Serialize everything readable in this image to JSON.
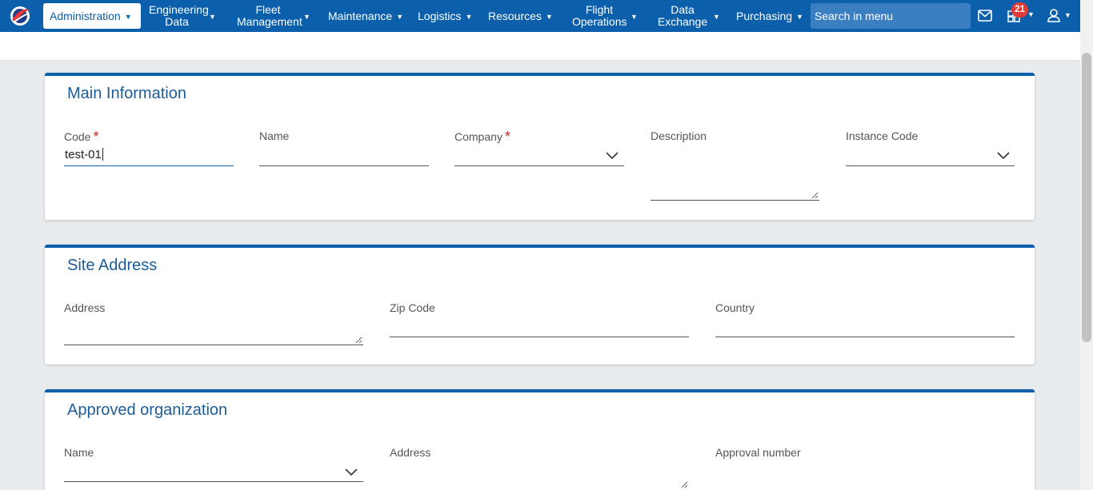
{
  "nav": {
    "items": [
      {
        "label": "Administration",
        "active": true
      },
      {
        "label": "Engineering Data"
      },
      {
        "label": "Fleet Management"
      },
      {
        "label": "Maintenance"
      },
      {
        "label": "Logistics"
      },
      {
        "label": "Resources"
      },
      {
        "label": "Flight Operations"
      },
      {
        "label": "Data Exchange"
      },
      {
        "label": "Purchasing"
      }
    ],
    "search_placeholder": "Search in menu",
    "notification_count": "21"
  },
  "sections": {
    "main": {
      "title": "Main Information",
      "code_label": "Code",
      "code_value": "test-01",
      "name_label": "Name",
      "company_label": "Company",
      "description_label": "Description",
      "instance_label": "Instance Code"
    },
    "site": {
      "title": "Site Address",
      "address_label": "Address",
      "zip_label": "Zip Code",
      "country_label": "Country"
    },
    "approved": {
      "title": "Approved organization",
      "name_label": "Name",
      "address_label": "Address",
      "approval_label": "Approval number"
    }
  },
  "colors": {
    "brand": "#0b5fab",
    "title": "#1c5d99",
    "required": "#c62828",
    "badge": "#e53935"
  }
}
